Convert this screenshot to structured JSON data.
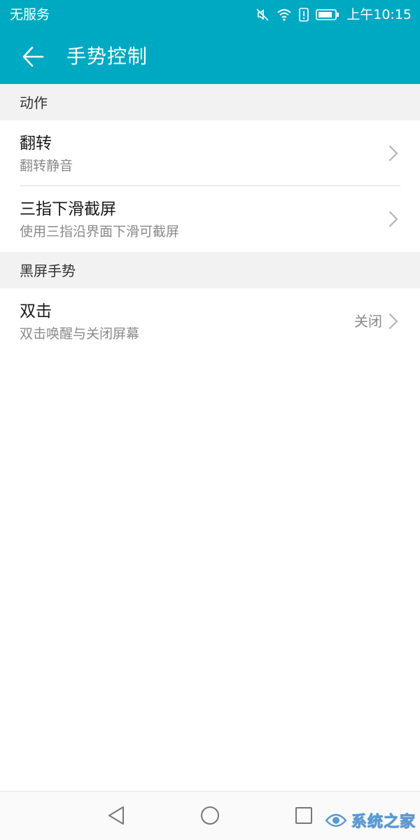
{
  "status_bar": {
    "carrier": "无服务",
    "time": "上午10:15",
    "icons": [
      "mute-icon",
      "wifi-icon",
      "sim-alert-icon",
      "battery-icon"
    ]
  },
  "app_bar": {
    "back_icon": "arrow-left-icon",
    "title": "手势控制"
  },
  "sections": [
    {
      "header": "动作",
      "items": [
        {
          "title": "翻转",
          "subtitle": "翻转静音",
          "value": ""
        },
        {
          "title": "三指下滑截屏",
          "subtitle": "使用三指沿界面下滑可截屏",
          "value": ""
        }
      ]
    },
    {
      "header": "黑屏手势",
      "items": [
        {
          "title": "双击",
          "subtitle": "双击唤醒与关闭屏幕",
          "value": "关闭"
        }
      ]
    }
  ],
  "nav_bar": {
    "buttons": [
      "back-triangle-icon",
      "home-circle-icon",
      "recents-square-icon"
    ]
  },
  "watermark": {
    "text": "系统之家"
  },
  "colors": {
    "accent": "#00a9c2",
    "section_bg": "#f2f2f2",
    "secondary_text": "#8a8a8a"
  }
}
